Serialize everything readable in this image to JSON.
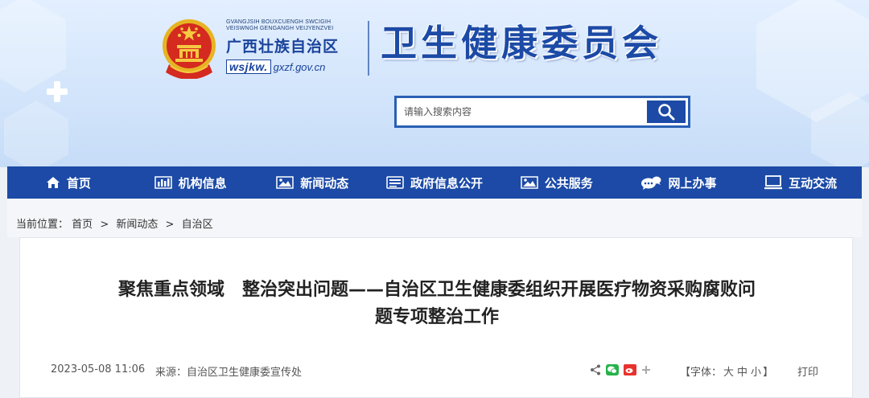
{
  "header": {
    "org_sub_line1": "GVANGJSIH BOUXCUENGH SWCIGIH",
    "org_sub_line2": "VEISWNGH GENGANGH VEIJYENZVEI",
    "org_name": "广西壮族自治区",
    "url_prefix": "wsjkw.",
    "url_suffix": "gxzf.gov.cn",
    "brand_title": "卫生健康委员会"
  },
  "search": {
    "placeholder": "请输入搜索内容",
    "button_icon": "search-icon"
  },
  "nav": {
    "items": [
      {
        "label": "首页",
        "icon": "home-icon"
      },
      {
        "label": "机构信息",
        "icon": "bar-chart-icon"
      },
      {
        "label": "新闻动态",
        "icon": "image-icon"
      },
      {
        "label": "政府信息公开",
        "icon": "document-icon"
      },
      {
        "label": "公共服务",
        "icon": "image-icon"
      },
      {
        "label": "网上办事",
        "icon": "chat-icon"
      },
      {
        "label": "互动交流",
        "icon": "monitor-icon"
      }
    ]
  },
  "breadcrumb": {
    "prefix": "当前位置：",
    "items": [
      "首页",
      "新闻动态",
      "自治区"
    ],
    "separator": ">"
  },
  "article": {
    "title_line1": "聚焦重点领域　整治突出问题——自治区卫生健康委组织开展医疗物资采购腐败问",
    "title_line2": "题专项整治工作",
    "date": "2023-05-08 11:06",
    "source": "来源：自治区卫生健康委宣传处",
    "font_size_prefix": "【字体：",
    "font_size_options": [
      "大",
      "中",
      "小"
    ],
    "font_size_suffix": "】",
    "print_label": "打印"
  },
  "colors": {
    "brand_blue": "#1c4aa6",
    "header_bg": "#d3e5fb",
    "wechat_green": "#27b24a",
    "weibo_red": "#e8322d"
  }
}
